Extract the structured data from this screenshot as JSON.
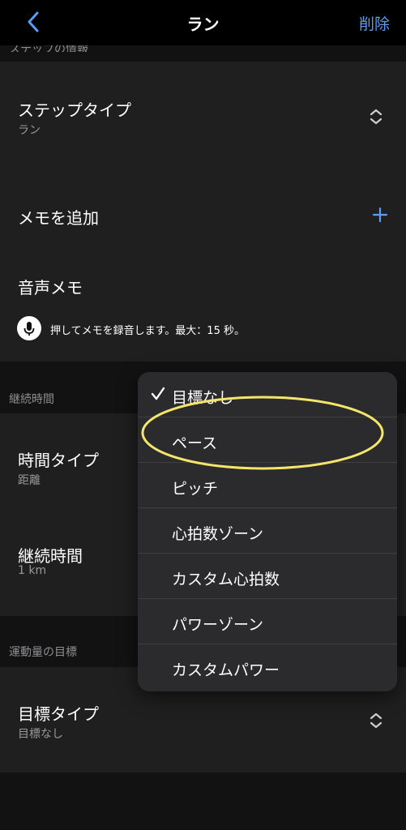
{
  "nav": {
    "title": "ラン",
    "delete_label": "削除"
  },
  "step_info": {
    "section_label": "ステップの情報",
    "step_type_label": "ステップタイプ",
    "step_type_value": "ラン",
    "add_memo_label": "メモを追加",
    "voice_memo_label": "音声メモ",
    "voice_memo_hint": "押してメモを録音します。最大：15 秒。"
  },
  "duration": {
    "section_label": "継続時間",
    "time_type_label": "時間タイプ",
    "time_type_value": "距離",
    "duration_label": "継続時間",
    "duration_value": "1 km"
  },
  "target": {
    "section_label": "運動量の目標",
    "target_type_label": "目標タイプ",
    "target_type_value": "目標なし"
  },
  "menu": {
    "items": [
      {
        "label": "目標なし",
        "selected": true
      },
      {
        "label": "ペース",
        "selected": false
      },
      {
        "label": "ピッチ",
        "selected": false
      },
      {
        "label": "心拍数ゾーン",
        "selected": false
      },
      {
        "label": "カスタム心拍数",
        "selected": false
      },
      {
        "label": "パワーゾーン",
        "selected": false
      },
      {
        "label": "カスタムパワー",
        "selected": false
      }
    ]
  },
  "colors": {
    "accent": "#5b9cf5",
    "highlight": "#f5e66b",
    "background": "#121212",
    "card": "#1f1f1f",
    "menu": "#2b2b2d"
  }
}
